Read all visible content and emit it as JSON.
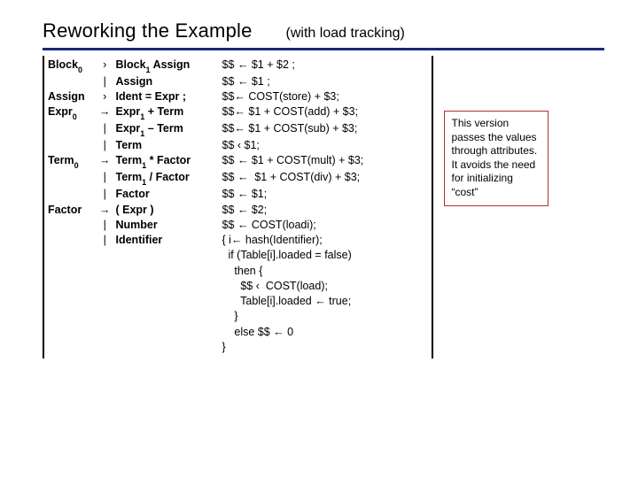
{
  "header": {
    "title": "Reworking the Example",
    "subtitle": "(with load tracking)"
  },
  "grammar": [
    {
      "lhs": "Block|0",
      "arr": "›",
      "rhs": "Block|1 Assign",
      "sem": "$$ ← $1 + $2 ;"
    },
    {
      "lhs": "",
      "arr": "|",
      "rhs": "Assign",
      "sem": "$$ ← $1 ;"
    },
    {
      "lhs": "Assign",
      "arr": "›",
      "rhs": "Ident = Expr ;",
      "sem": "$$← COST(store) + $3;"
    },
    {
      "lhs": "Expr|0",
      "arr": "→",
      "rhs": "Expr|1 + Term",
      "sem": "$$← $1 + COST(add) + $3;"
    },
    {
      "lhs": "",
      "arr": "|",
      "rhs": "Expr|1 – Term",
      "sem": "$$← $1 + COST(sub) + $3;"
    },
    {
      "lhs": "",
      "arr": "|",
      "rhs": "Term",
      "sem": "$$ ‹ $1;"
    },
    {
      "lhs": "Term|0",
      "arr": "→",
      "rhs": "Term|1 * Factor",
      "sem": "$$ ← $1 + COST(mult) + $3;"
    },
    {
      "lhs": "",
      "arr": "|",
      "rhs": "Term|1 / Factor",
      "sem": "$$ ←  $1 + COST(div) + $3;"
    },
    {
      "lhs": "",
      "arr": "|",
      "rhs": "Factor",
      "sem": "$$ ← $1;"
    },
    {
      "lhs": "Factor",
      "arr": "→",
      "rhs": "( Expr )",
      "sem": "$$ ← $2;"
    },
    {
      "lhs": "",
      "arr": "|",
      "rhs": "Number",
      "sem": "$$ ← COST(loadi);"
    },
    {
      "lhs": "",
      "arr": "|",
      "rhs": "Identifier",
      "sem": "{ i← hash(Identifier);"
    },
    {
      "lhs": "",
      "arr": "",
      "rhs": "",
      "sem": "  if (Table[i].loaded = false)"
    },
    {
      "lhs": "",
      "arr": "",
      "rhs": "",
      "sem": "    then {"
    },
    {
      "lhs": "",
      "arr": "",
      "rhs": "",
      "sem": "      $$ ‹  COST(load);"
    },
    {
      "lhs": "",
      "arr": "",
      "rhs": "",
      "sem": "      Table[i].loaded ← true;"
    },
    {
      "lhs": "",
      "arr": "",
      "rhs": "",
      "sem": "    }"
    },
    {
      "lhs": "",
      "arr": "",
      "rhs": "",
      "sem": "    else $$ ← 0"
    },
    {
      "lhs": "",
      "arr": "",
      "rhs": "",
      "sem": "}"
    }
  ],
  "note": {
    "text": "This version passes the values through attributes.  It avoids the need for initializing “cost”"
  }
}
